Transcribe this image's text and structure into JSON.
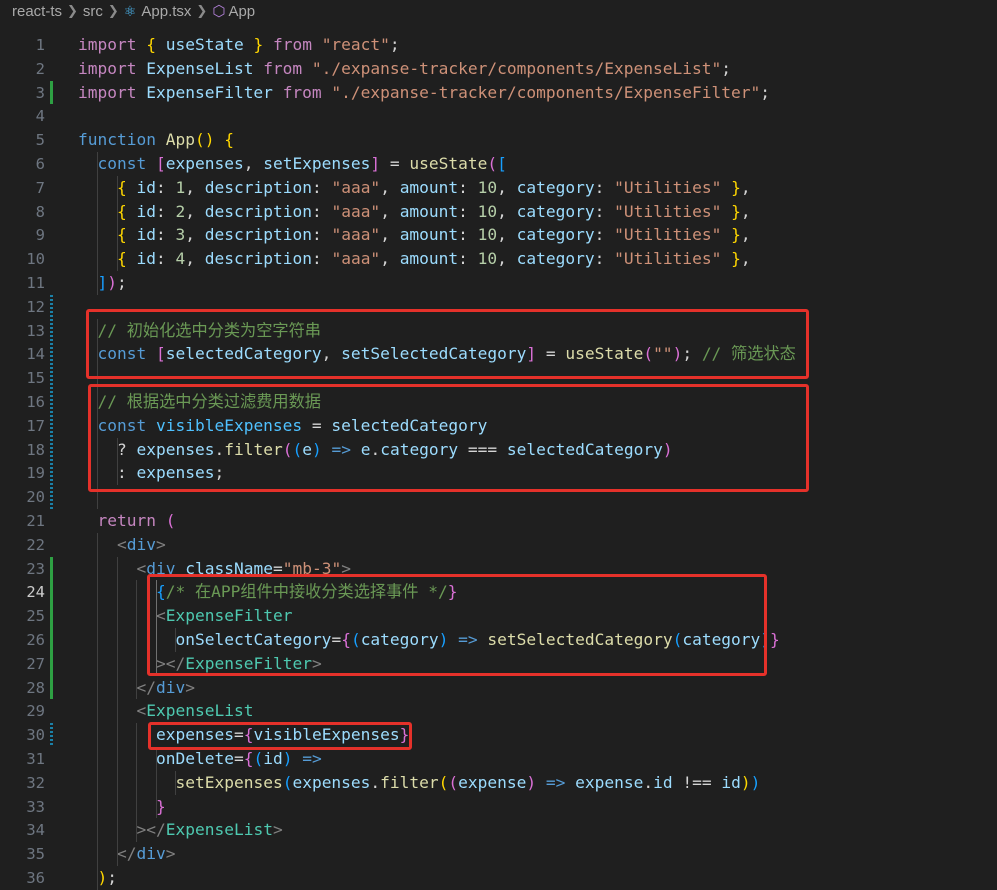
{
  "breadcrumb": {
    "segments": [
      "react-ts",
      "src",
      "App.tsx",
      "App"
    ],
    "file_icon": "react-icon",
    "symbol_icon": "component-symbol-icon"
  },
  "editor": {
    "language": "tsx",
    "active_line": 24,
    "line_numbers": [
      "1",
      "2",
      "3",
      "4",
      "5",
      "6",
      "7",
      "8",
      "9",
      "10",
      "11",
      "12",
      "13",
      "14",
      "15",
      "16",
      "17",
      "18",
      "19",
      "20",
      "21",
      "22",
      "23",
      "24",
      "25",
      "26",
      "27",
      "28",
      "29",
      "30",
      "31",
      "32",
      "33",
      "34",
      "35",
      "36"
    ],
    "lines": [
      "import { useState } from \"react\";",
      "import ExpenseList from \"./expanse-tracker/components/ExpenseList\";",
      "import ExpenseFilter from \"./expanse-tracker/components/ExpenseFilter\";",
      "",
      "function App() {",
      "  const [expenses, setExpenses] = useState([",
      "    { id: 1, description: \"aaa\", amount: 10, category: \"Utilities\" },",
      "    { id: 2, description: \"aaa\", amount: 10, category: \"Utilities\" },",
      "    { id: 3, description: \"aaa\", amount: 10, category: \"Utilities\" },",
      "    { id: 4, description: \"aaa\", amount: 10, category: \"Utilities\" },",
      "  ]);",
      "",
      "  // 初始化选中分类为空字符串",
      "  const [selectedCategory, setSelectedCategory] = useState(\"\"); // 筛选状态",
      "",
      "  // 根据选中分类过滤费用数据",
      "  const visibleExpenses = selectedCategory",
      "    ? expenses.filter((e) => e.category === selectedCategory)",
      "    : expenses;",
      "",
      "  return (",
      "    <div>",
      "      <div className=\"mb-3\">",
      "        {/* 在APP组件中接收分类选择事件 */}",
      "        <ExpenseFilter",
      "          onSelectCategory={(category) => setSelectedCategory(category)}",
      "        ></ExpenseFilter>",
      "      </div>",
      "      <ExpenseList",
      "        expenses={visibleExpenses}",
      "        onDelete={(id) =>",
      "          setExpenses(expenses.filter((expense) => expense.id !== id))",
      "        }",
      "      ></ExpenseList>",
      "    </div>",
      "  );"
    ]
  },
  "annotations": {
    "highlight_color": "#e5312a",
    "boxes": [
      "selected-category-state",
      "visible-expenses-filter",
      "expense-filter-usage",
      "expenses-prop"
    ]
  }
}
